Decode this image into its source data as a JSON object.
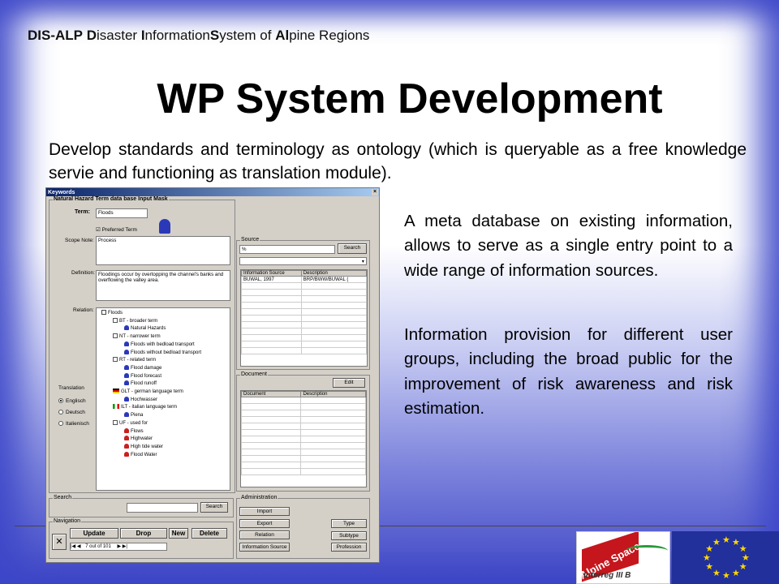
{
  "header": {
    "parts": [
      {
        "b": "DIS-ALP"
      },
      {
        "n": " "
      },
      {
        "b": "D"
      },
      {
        "n": "isaster "
      },
      {
        "b": "I"
      },
      {
        "n": "nformation"
      },
      {
        "b": "S"
      },
      {
        "n": "ystem of "
      },
      {
        "b": "Al"
      },
      {
        "n": "pine Regions"
      }
    ]
  },
  "title": "WP System Development",
  "intro": "Develop standards and terminology as ontology (which is queryable as a free knowledge servie and functioning as translation module).",
  "para1": "A meta database on existing information, allows to serve as a single entry point to a wide range of information sources.",
  "para2": "Information provision for different user groups, including the broad public for the improvement of risk awareness and risk estimation.",
  "dialog": {
    "window_title": "Keywords",
    "close_glyph": "×",
    "group_input": "Natural Hazard Term data base Input Mask",
    "term_label": "Term:",
    "term_value": "Floods",
    "preferred_label": "Preferred Term",
    "scope_label": "Scope Note:",
    "scope_value": "Process",
    "definition_label": "Definition:",
    "definition_value": "Floodings occur by overtopping the channel's banks and overflowing the valley area.",
    "relation_label": "Relation:",
    "tree": [
      {
        "t": "Floods",
        "lvl": 0,
        "ic": "check"
      },
      {
        "t": "BT - broader term",
        "lvl": 1,
        "ic": "rel"
      },
      {
        "t": "Natural Hazards",
        "lvl": 2,
        "ic": "bell"
      },
      {
        "t": "NT - narrower term",
        "lvl": 1,
        "ic": "rel"
      },
      {
        "t": "Floods with bedload transport",
        "lvl": 2,
        "ic": "bell"
      },
      {
        "t": "Floods without bedload transport",
        "lvl": 2,
        "ic": "bell"
      },
      {
        "t": "RT - related term",
        "lvl": 1,
        "ic": "rel"
      },
      {
        "t": "Flood damage",
        "lvl": 2,
        "ic": "bell"
      },
      {
        "t": "Flood forecast",
        "lvl": 2,
        "ic": "bell"
      },
      {
        "t": "Flood runoff",
        "lvl": 2,
        "ic": "bell"
      },
      {
        "t": "GLT - german language term",
        "lvl": 1,
        "ic": "flag-de"
      },
      {
        "t": "Hochwasser",
        "lvl": 2,
        "ic": "bell"
      },
      {
        "t": "ILT - italian language term",
        "lvl": 1,
        "ic": "flag-it"
      },
      {
        "t": "Piena",
        "lvl": 2,
        "ic": "bell"
      },
      {
        "t": "UF - used for",
        "lvl": 1,
        "ic": "rel"
      },
      {
        "t": "Flows",
        "lvl": 2,
        "ic": "bellr"
      },
      {
        "t": "Highwater",
        "lvl": 2,
        "ic": "bellr"
      },
      {
        "t": "High tide water",
        "lvl": 2,
        "ic": "bellr"
      },
      {
        "t": "Flood Water",
        "lvl": 2,
        "ic": "bellr"
      }
    ],
    "translation_label": "Translation",
    "translations": [
      {
        "t": "Englisch",
        "on": true
      },
      {
        "t": "Deutsch",
        "on": false
      },
      {
        "t": "Italienisch",
        "on": false
      }
    ],
    "source_group": "Source",
    "source_value": "%",
    "search_btn": "Search",
    "source_headers": [
      "Information Source",
      "Description"
    ],
    "source_rows": [
      [
        "BUWAL, 1997",
        "BRP/BWW/BUWAL ("
      ]
    ],
    "document_group": "Document",
    "edit_btn": "Edit",
    "document_headers": [
      "Document",
      "Description"
    ],
    "search_group": "Search",
    "search2_btn": "Search",
    "navigation_group": "Navigation",
    "nav_buttons": [
      "Update",
      "Drop",
      "New",
      "Delete"
    ],
    "record_text": "7 out of 101",
    "admin_group": "Administration",
    "admin_left": [
      "Import",
      "Export",
      "Relation",
      "Information Source"
    ],
    "admin_right": [
      "Type",
      "Subtype",
      "Profession"
    ]
  },
  "logos": {
    "alpine_top": "Alpine Space",
    "alpine_bottom": "Interreg III B"
  },
  "colors": {
    "frame_blue": "#3e46c6",
    "eu_blue": "#21309b",
    "eu_star": "#ffd700",
    "alpine_red": "#c4161c"
  }
}
